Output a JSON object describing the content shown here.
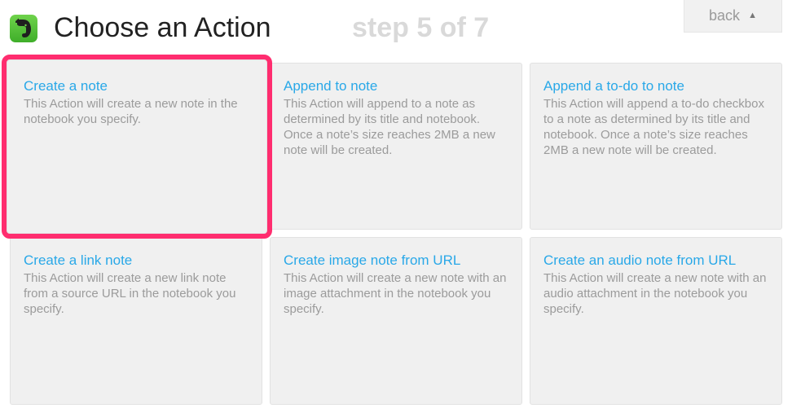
{
  "header": {
    "app_icon": "evernote-elephant-icon",
    "title": "Choose an Action",
    "step": "step 5 of 7",
    "back_label": "back",
    "back_caret": "▲"
  },
  "colors": {
    "accent_link": "#29a8e8",
    "selection_outline": "#ff2d6f",
    "card_background": "#f0f0f0",
    "app_icon_green": "#4cbb2f"
  },
  "actions": [
    {
      "title": "Create a note",
      "description": "This Action will create a new note in the notebook you specify.",
      "selected": true
    },
    {
      "title": "Append to note",
      "description": "This Action will append to a note as determined by its title and notebook. Once a note’s size reaches 2MB a new note will be created.",
      "selected": false
    },
    {
      "title": "Append a to-do to note",
      "description": "This Action will append a to-do checkbox to a note as determined by its title and notebook. Once a note’s size reaches 2MB a new note will be created.",
      "selected": false
    },
    {
      "title": "Create a link note",
      "description": "This Action will create a new link note from a source URL in the notebook you specify.",
      "selected": false
    },
    {
      "title": "Create image note from URL",
      "description": "This Action will create a new note with an image attachment in the notebook you specify.",
      "selected": false
    },
    {
      "title": "Create an audio note from URL",
      "description": "This Action will create a new note with an audio attachment in the notebook you specify.",
      "selected": false
    }
  ]
}
